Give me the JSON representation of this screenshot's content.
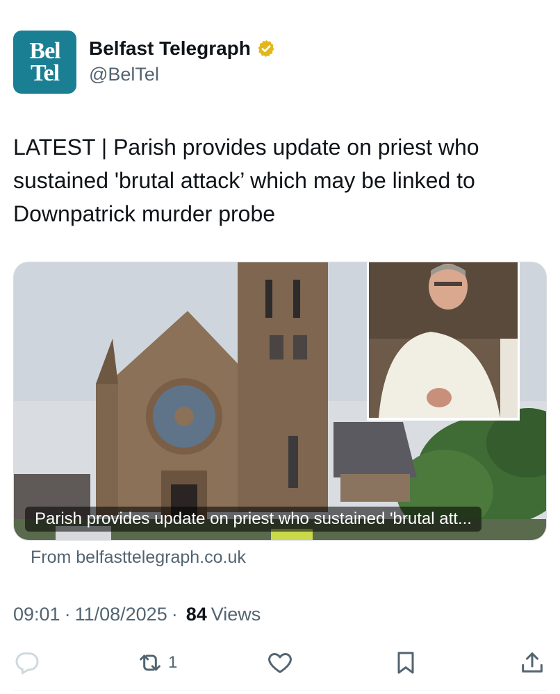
{
  "account": {
    "avatar_line1": "Bel",
    "avatar_line2": "Tel",
    "display_name": "Belfast Telegraph",
    "handle": "@BelTel",
    "verified_icon": "verified-badge-gold"
  },
  "tweet": {
    "text": "LATEST | Parish provides update on priest who sustained 'brutal attack’ which may be linked to Downpatrick murder probe"
  },
  "card": {
    "caption": "Parish provides update on priest who sustained 'brutal att...",
    "source": "From belfasttelegraph.co.uk"
  },
  "meta": {
    "time": "09:01",
    "date": "11/08/2025",
    "views_count": "84",
    "views_label": "Views",
    "separator": "·"
  },
  "actions": {
    "reply_icon": "reply-icon",
    "retweet_icon": "retweet-icon",
    "retweet_count": "1",
    "like_icon": "heart-icon",
    "bookmark_icon": "bookmark-icon",
    "share_icon": "share-icon"
  },
  "colors": {
    "avatar_bg": "#1b7f94",
    "text_primary": "#0f1419",
    "text_secondary": "#536471",
    "verified": "#e2b719"
  }
}
